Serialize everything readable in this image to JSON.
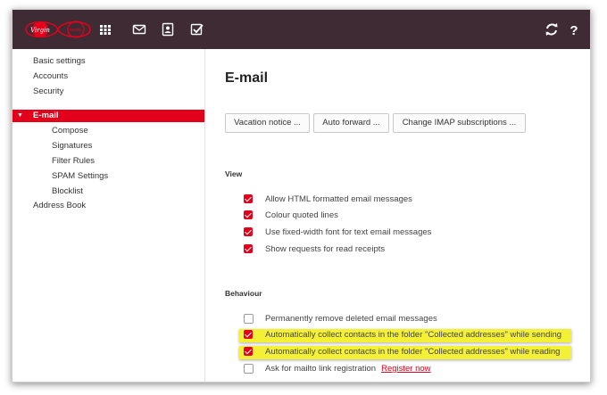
{
  "brand": {
    "logo_text": "Virgin media",
    "accent": "#e3001b",
    "topbar_color": "#3e2b33"
  },
  "topbar": {
    "icons": [
      "apps-grid-icon",
      "mail-icon",
      "contacts-icon",
      "tasks-icon",
      "refresh-icon",
      "help-icon"
    ]
  },
  "sidebar": {
    "items": [
      {
        "label": "Basic settings"
      },
      {
        "label": "Accounts"
      },
      {
        "label": "Security"
      },
      {
        "label": "E-mail"
      },
      {
        "label": "Compose"
      },
      {
        "label": "Signatures"
      },
      {
        "label": "Filter Rules"
      },
      {
        "label": "SPAM Settings"
      },
      {
        "label": "Blocklist"
      },
      {
        "label": "Address Book"
      }
    ]
  },
  "main": {
    "title": "E-mail",
    "buttons": [
      "Vacation notice ...",
      "Auto forward ...",
      "Change IMAP subscriptions ..."
    ],
    "view": {
      "heading": "View",
      "options": [
        {
          "label": "Allow HTML formatted email messages",
          "checked": true
        },
        {
          "label": "Colour quoted lines",
          "checked": true
        },
        {
          "label": "Use fixed-width font for text email messages",
          "checked": true
        },
        {
          "label": "Show requests for read receipts",
          "checked": true
        }
      ]
    },
    "behaviour": {
      "heading": "Behaviour",
      "options": [
        {
          "label": "Permanently remove deleted email messages",
          "checked": false
        },
        {
          "label": "Automatically collect contacts in the folder \"Collected addresses\" while sending",
          "checked": true,
          "highlighted": true
        },
        {
          "label": "Automatically collect contacts in the folder \"Collected addresses\" while reading",
          "checked": true,
          "highlighted": true
        },
        {
          "label": "Ask for mailto link registration",
          "checked": false,
          "link": "Register now"
        }
      ]
    }
  }
}
